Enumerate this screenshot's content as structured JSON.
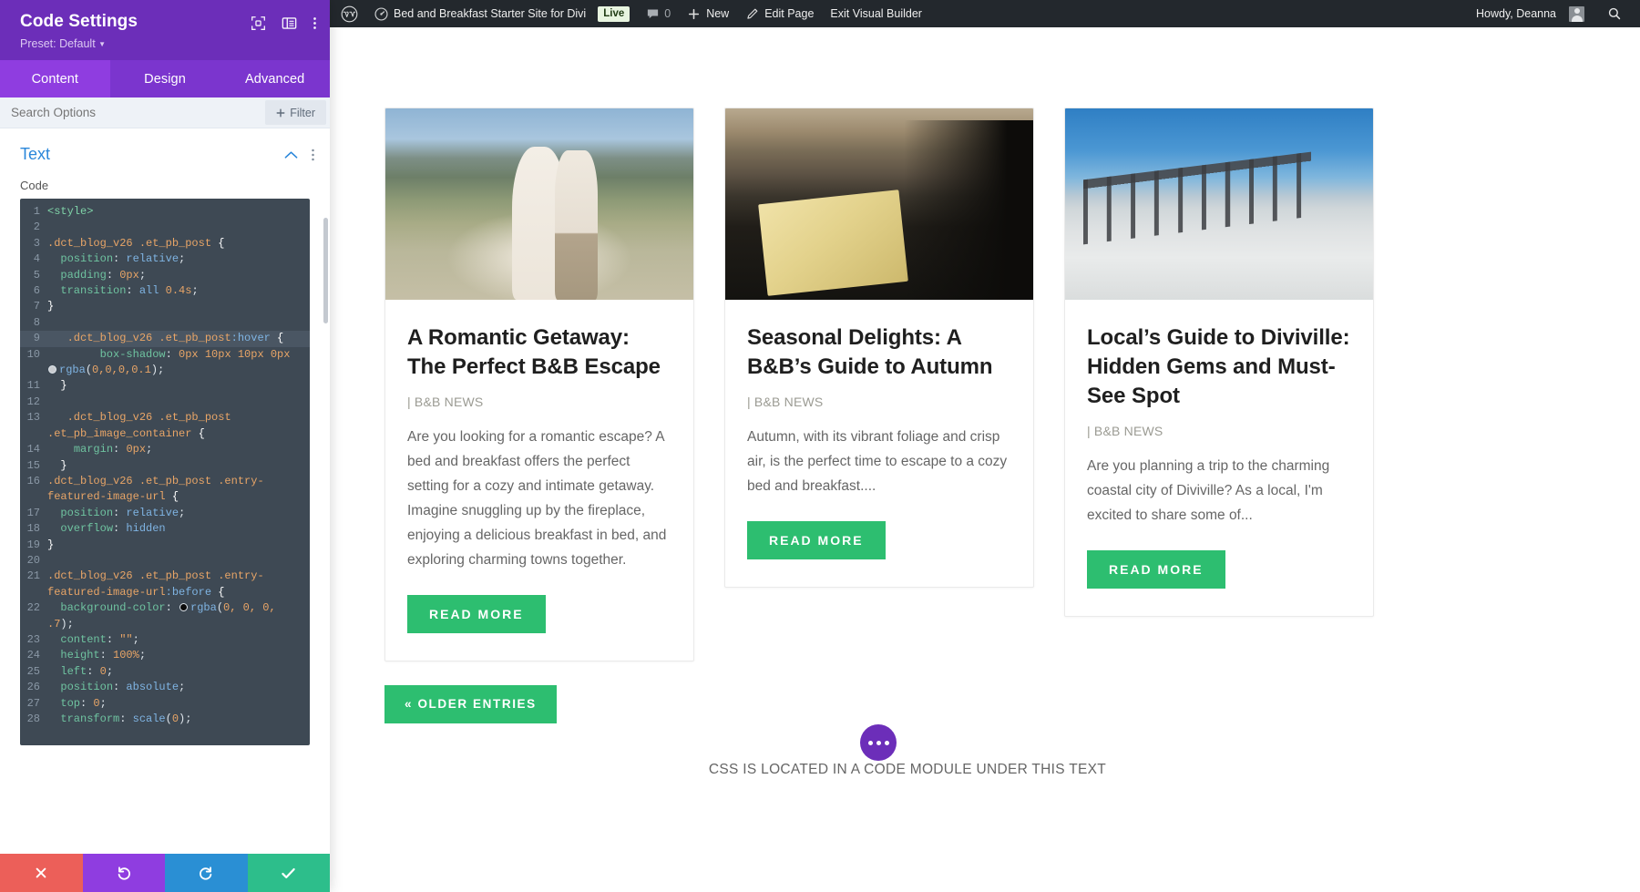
{
  "adminbar": {
    "site_title": "Bed and Breakfast Starter Site for Divi",
    "live_badge": "Live",
    "comment_count": "0",
    "new_label": "New",
    "edit_page_label": "Edit Page",
    "exit_builder_label": "Exit Visual Builder",
    "howdy": "Howdy, Deanna",
    "bar_bg": "#23282d",
    "live_badge_bg": "#e8f5e0"
  },
  "panel": {
    "title": "Code Settings",
    "preset": "Preset: Default",
    "header_bg": "#6c2eb9",
    "tabs": [
      {
        "label": "Content",
        "active": true
      },
      {
        "label": "Design",
        "active": false
      },
      {
        "label": "Advanced",
        "active": false
      }
    ],
    "search_placeholder": "Search Options",
    "filter_label": "Filter",
    "section": {
      "title": "Text",
      "accent": "#2b87da"
    },
    "field_label": "Code",
    "footer": {
      "cancel_color": "#ec5f59",
      "undo_color": "#8f3de0",
      "redo_color": "#2a8fd4",
      "save_color": "#2dbe8b"
    }
  },
  "code_editor": {
    "lines": [
      {
        "n": "1",
        "segments": [
          {
            "t": "<style>",
            "c": "t-tag"
          }
        ]
      },
      {
        "n": "2",
        "segments": []
      },
      {
        "n": "3",
        "segments": [
          {
            "t": ".dct_blog_v26 .et_pb_post ",
            "c": "t-sel"
          },
          {
            "t": "{",
            "c": "t-white"
          }
        ]
      },
      {
        "n": "4",
        "segments": [
          {
            "t": "  position",
            "c": "t-prop"
          },
          {
            "t": ": ",
            "c": "t-punc"
          },
          {
            "t": "relative",
            "c": "t-val"
          },
          {
            "t": ";",
            "c": "t-punc"
          }
        ]
      },
      {
        "n": "5",
        "segments": [
          {
            "t": "  padding",
            "c": "t-prop"
          },
          {
            "t": ": ",
            "c": "t-punc"
          },
          {
            "t": "0px",
            "c": "t-num"
          },
          {
            "t": ";",
            "c": "t-punc"
          }
        ]
      },
      {
        "n": "6",
        "segments": [
          {
            "t": "  transition",
            "c": "t-prop"
          },
          {
            "t": ": ",
            "c": "t-punc"
          },
          {
            "t": "all ",
            "c": "t-val"
          },
          {
            "t": "0.4s",
            "c": "t-num"
          },
          {
            "t": ";",
            "c": "t-punc"
          }
        ]
      },
      {
        "n": "7",
        "segments": [
          {
            "t": "}",
            "c": "t-white"
          }
        ]
      },
      {
        "n": "8",
        "segments": []
      },
      {
        "n": "9",
        "highlight": true,
        "segments": [
          {
            "t": "   .dct_blog_v26 .et_pb_post",
            "c": "t-sel"
          },
          {
            "t": ":hover",
            "c": "t-val"
          },
          {
            "t": " {",
            "c": "t-white"
          }
        ]
      },
      {
        "n": "10",
        "segments": [
          {
            "t": "        box-shadow",
            "c": "t-prop"
          },
          {
            "t": ": ",
            "c": "t-punc"
          },
          {
            "t": "0px 10px 10px 0px ",
            "c": "t-num"
          },
          {
            "t": "@swatch-light@",
            "c": "swatch"
          },
          {
            "t": "rgba",
            "c": "t-val"
          },
          {
            "t": "(",
            "c": "t-punc"
          },
          {
            "t": "0,0,0,0.1",
            "c": "t-num"
          },
          {
            "t": ");",
            "c": "t-punc"
          }
        ]
      },
      {
        "n": "11",
        "segments": [
          {
            "t": "  }",
            "c": "t-white"
          }
        ]
      },
      {
        "n": "12",
        "segments": []
      },
      {
        "n": "13",
        "segments": [
          {
            "t": "   .dct_blog_v26 .et_pb_post .et_pb_image_container ",
            "c": "t-sel"
          },
          {
            "t": "{",
            "c": "t-white"
          }
        ]
      },
      {
        "n": "14",
        "segments": [
          {
            "t": "    margin",
            "c": "t-prop"
          },
          {
            "t": ": ",
            "c": "t-punc"
          },
          {
            "t": "0px",
            "c": "t-num"
          },
          {
            "t": ";",
            "c": "t-punc"
          }
        ]
      },
      {
        "n": "15",
        "segments": [
          {
            "t": "  }",
            "c": "t-white"
          }
        ]
      },
      {
        "n": "16",
        "segments": [
          {
            "t": ".dct_blog_v26 .et_pb_post .entry-featured-image-url ",
            "c": "t-sel"
          },
          {
            "t": "{",
            "c": "t-white"
          }
        ]
      },
      {
        "n": "17",
        "segments": [
          {
            "t": "  position",
            "c": "t-prop"
          },
          {
            "t": ": ",
            "c": "t-punc"
          },
          {
            "t": "relative",
            "c": "t-val"
          },
          {
            "t": ";",
            "c": "t-punc"
          }
        ]
      },
      {
        "n": "18",
        "segments": [
          {
            "t": "  overflow",
            "c": "t-prop"
          },
          {
            "t": ": ",
            "c": "t-punc"
          },
          {
            "t": "hidden",
            "c": "t-val"
          }
        ]
      },
      {
        "n": "19",
        "segments": [
          {
            "t": "}",
            "c": "t-white"
          }
        ]
      },
      {
        "n": "20",
        "segments": []
      },
      {
        "n": "21",
        "segments": [
          {
            "t": ".dct_blog_v26 .et_pb_post .entry-featured-image-url",
            "c": "t-sel"
          },
          {
            "t": ":before",
            "c": "t-val"
          },
          {
            "t": " {",
            "c": "t-white"
          }
        ]
      },
      {
        "n": "22",
        "segments": [
          {
            "t": "  background-color",
            "c": "t-prop"
          },
          {
            "t": ": ",
            "c": "t-punc"
          },
          {
            "t": "@swatch-dark@",
            "c": "swatch"
          },
          {
            "t": "rgba",
            "c": "t-val"
          },
          {
            "t": "(",
            "c": "t-punc"
          },
          {
            "t": "0, 0, 0, .7",
            "c": "t-num"
          },
          {
            "t": ");",
            "c": "t-punc"
          }
        ]
      },
      {
        "n": "23",
        "segments": [
          {
            "t": "  content",
            "c": "t-prop"
          },
          {
            "t": ": ",
            "c": "t-punc"
          },
          {
            "t": "\"\"",
            "c": "t-num"
          },
          {
            "t": ";",
            "c": "t-punc"
          }
        ]
      },
      {
        "n": "24",
        "segments": [
          {
            "t": "  height",
            "c": "t-prop"
          },
          {
            "t": ": ",
            "c": "t-punc"
          },
          {
            "t": "100%",
            "c": "t-num"
          },
          {
            "t": ";",
            "c": "t-punc"
          }
        ]
      },
      {
        "n": "25",
        "segments": [
          {
            "t": "  left",
            "c": "t-prop"
          },
          {
            "t": ": ",
            "c": "t-punc"
          },
          {
            "t": "0",
            "c": "t-num"
          },
          {
            "t": ";",
            "c": "t-punc"
          }
        ]
      },
      {
        "n": "26",
        "segments": [
          {
            "t": "  position",
            "c": "t-prop"
          },
          {
            "t": ": ",
            "c": "t-punc"
          },
          {
            "t": "absolute",
            "c": "t-val"
          },
          {
            "t": ";",
            "c": "t-punc"
          }
        ]
      },
      {
        "n": "27",
        "segments": [
          {
            "t": "  top",
            "c": "t-prop"
          },
          {
            "t": ": ",
            "c": "t-punc"
          },
          {
            "t": "0",
            "c": "t-num"
          },
          {
            "t": ";",
            "c": "t-punc"
          }
        ]
      },
      {
        "n": "28",
        "segments": [
          {
            "t": "  transform",
            "c": "t-prop"
          },
          {
            "t": ": ",
            "c": "t-punc"
          },
          {
            "t": "scale",
            "c": "t-val"
          },
          {
            "t": "(",
            "c": "t-punc"
          },
          {
            "t": "0",
            "c": "t-num"
          },
          {
            "t": ");",
            "c": "t-punc"
          }
        ]
      }
    ]
  },
  "blog": {
    "posts": [
      {
        "title": "A Romantic Getaway: The Perfect B&B Escape",
        "meta": "| B&B NEWS",
        "excerpt": "Are you looking for a romantic escape? A bed and breakfast offers the perfect setting for a cozy and intimate getaway. Imagine snuggling up by the fireplace, enjoying a delicious breakfast in bed, and exploring charming towns together.",
        "button": "READ MORE",
        "image": "couple-embracing-mountain-view"
      },
      {
        "title": "Seasonal Delights: A B&B’s Guide to Autumn",
        "meta": "| B&B NEWS",
        "excerpt": "Autumn, with its vibrant foliage and crisp air, is the perfect time to escape to a cozy bed and breakfast....",
        "button": "READ MORE",
        "image": "person-reading-map-autumn"
      },
      {
        "title": "Local’s Guide to Diviville: Hidden Gems and Must-See Spot",
        "meta": "| B&B NEWS",
        "excerpt": "Are you planning a trip to the charming coastal city of Diviville? As a local, I'm excited to share some of...",
        "button": "READ MORE",
        "image": "beach-pier-ocean"
      }
    ],
    "older_entries": "« OLDER ENTRIES",
    "bottom_note": "CSS IS LOCATED IN A CODE MODULE UNDER THIS TEXT",
    "button_color": "#2dbe70",
    "accent_purple": "#6c2eb9"
  }
}
